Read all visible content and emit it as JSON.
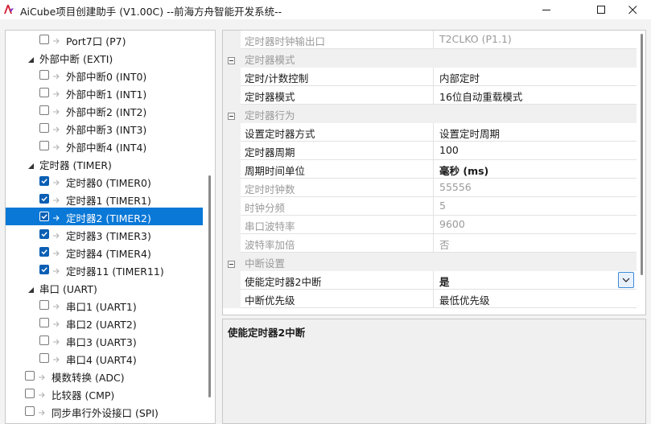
{
  "window": {
    "title": "AiCube项目创建助手 (V1.00C) --前海方舟智能开发系统--"
  },
  "tree": {
    "rows": [
      {
        "label": "Port7口 (P7)",
        "checked": false
      },
      {
        "label": "外部中断 (EXTI)"
      },
      {
        "label": "外部中断0 (INT0)",
        "checked": false
      },
      {
        "label": "外部中断1 (INT1)",
        "checked": false
      },
      {
        "label": "外部中断2 (INT2)",
        "checked": false
      },
      {
        "label": "外部中断3 (INT3)",
        "checked": false
      },
      {
        "label": "外部中断4 (INT4)",
        "checked": false
      },
      {
        "label": "定时器 (TIMER)"
      },
      {
        "label": "定时器0 (TIMER0)",
        "checked": true
      },
      {
        "label": "定时器1 (TIMER1)",
        "checked": true
      },
      {
        "label": "定时器2 (TIMER2)",
        "checked": true,
        "selected": true
      },
      {
        "label": "定时器3 (TIMER3)",
        "checked": true
      },
      {
        "label": "定时器4 (TIMER4)",
        "checked": true
      },
      {
        "label": "定时器11 (TIMER11)",
        "checked": true
      },
      {
        "label": "串口 (UART)"
      },
      {
        "label": "串口1 (UART1)",
        "checked": false
      },
      {
        "label": "串口2 (UART2)",
        "checked": false
      },
      {
        "label": "串口3 (UART3)",
        "checked": false
      },
      {
        "label": "串口4 (UART4)",
        "checked": false
      },
      {
        "label": "模数转换 (ADC)",
        "checked": false
      },
      {
        "label": "比较器 (CMP)",
        "checked": false
      },
      {
        "label": "同步串行外设接口 (SPI)",
        "checked": false
      }
    ]
  },
  "properties": {
    "rows": [
      {
        "name": "定时器时钟输出口",
        "value": "T2CLKO (P1.1)",
        "readonly": true
      },
      {
        "category": "定时器模式"
      },
      {
        "name": "定时/计数控制",
        "value": "内部定时"
      },
      {
        "name": "定时器模式",
        "value": "16位自动重载模式"
      },
      {
        "category": "定时器行为"
      },
      {
        "name": "设置定时器方式",
        "value": "设置定时周期"
      },
      {
        "name": "定时器周期",
        "value": "100"
      },
      {
        "name": "周期时间单位",
        "value": "毫秒 (ms)",
        "bold": true
      },
      {
        "name": "定时时钟数",
        "value": "55556",
        "readonly": true
      },
      {
        "name": "时钟分频",
        "value": "5",
        "readonly": true
      },
      {
        "name": "串口波特率",
        "value": "9600",
        "readonly": true
      },
      {
        "name": "波特率加倍",
        "value": "否",
        "readonly": true
      },
      {
        "category": "中断设置"
      },
      {
        "name": "使能定时器2中断",
        "value": "是",
        "bold": true,
        "dropdown": true
      },
      {
        "name": "中断优先级",
        "value": "最低优先级"
      }
    ]
  },
  "description": {
    "title": "使能定时器2中断"
  },
  "colors": {
    "selection": "#0a78d7",
    "checkbox_checked": "#0a5fb4",
    "readonly_text": "#9a9a9a"
  }
}
